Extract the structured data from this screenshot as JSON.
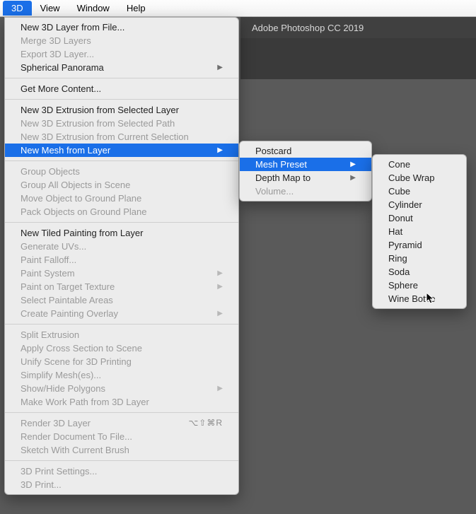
{
  "menubar": {
    "items": [
      "3D",
      "View",
      "Window",
      "Help"
    ],
    "active_index": 0
  },
  "app_title": "Adobe Photoshop CC 2019",
  "dropdown": {
    "groups": [
      [
        {
          "label": "New 3D Layer from File...",
          "enabled": true
        },
        {
          "label": "Merge 3D Layers",
          "enabled": false
        },
        {
          "label": "Export 3D Layer...",
          "enabled": false
        },
        {
          "label": "Spherical Panorama",
          "enabled": true,
          "submenu": true
        }
      ],
      [
        {
          "label": "Get More Content...",
          "enabled": true
        }
      ],
      [
        {
          "label": "New 3D Extrusion from Selected Layer",
          "enabled": true
        },
        {
          "label": "New 3D Extrusion from Selected Path",
          "enabled": false
        },
        {
          "label": "New 3D Extrusion from Current Selection",
          "enabled": false
        },
        {
          "label": "New Mesh from Layer",
          "enabled": true,
          "submenu": true,
          "highlight": true
        }
      ],
      [
        {
          "label": "Group Objects",
          "enabled": false
        },
        {
          "label": "Group All Objects in Scene",
          "enabled": false
        },
        {
          "label": "Move Object to Ground Plane",
          "enabled": false
        },
        {
          "label": "Pack Objects on Ground Plane",
          "enabled": false
        }
      ],
      [
        {
          "label": "New Tiled Painting from Layer",
          "enabled": true
        },
        {
          "label": "Generate UVs...",
          "enabled": false
        },
        {
          "label": "Paint Falloff...",
          "enabled": false
        },
        {
          "label": "Paint System",
          "enabled": false,
          "submenu": true
        },
        {
          "label": "Paint on Target Texture",
          "enabled": false,
          "submenu": true
        },
        {
          "label": "Select Paintable Areas",
          "enabled": false
        },
        {
          "label": "Create Painting Overlay",
          "enabled": false,
          "submenu": true
        }
      ],
      [
        {
          "label": "Split Extrusion",
          "enabled": false
        },
        {
          "label": "Apply Cross Section to Scene",
          "enabled": false
        },
        {
          "label": "Unify Scene for 3D Printing",
          "enabled": false
        },
        {
          "label": "Simplify Mesh(es)...",
          "enabled": false
        },
        {
          "label": "Show/Hide Polygons",
          "enabled": false,
          "submenu": true
        },
        {
          "label": "Make Work Path from 3D Layer",
          "enabled": false
        }
      ],
      [
        {
          "label": "Render 3D Layer",
          "enabled": false,
          "shortcut": "⌥⇧⌘R"
        },
        {
          "label": "Render Document To File...",
          "enabled": false
        },
        {
          "label": "Sketch With Current Brush",
          "enabled": false
        }
      ],
      [
        {
          "label": "3D Print Settings...",
          "enabled": false
        },
        {
          "label": "3D Print...",
          "enabled": false
        }
      ]
    ]
  },
  "submenu1": [
    {
      "label": "Postcard",
      "enabled": true
    },
    {
      "label": "Mesh Preset",
      "enabled": true,
      "submenu": true,
      "highlight": true
    },
    {
      "label": "Depth Map to",
      "enabled": true,
      "submenu": true
    },
    {
      "label": "Volume...",
      "enabled": false
    }
  ],
  "submenu2": [
    {
      "label": "Cone"
    },
    {
      "label": "Cube Wrap"
    },
    {
      "label": "Cube"
    },
    {
      "label": "Cylinder"
    },
    {
      "label": "Donut"
    },
    {
      "label": "Hat"
    },
    {
      "label": "Pyramid"
    },
    {
      "label": "Ring"
    },
    {
      "label": "Soda"
    },
    {
      "label": "Sphere"
    },
    {
      "label": "Wine Bottle"
    }
  ]
}
